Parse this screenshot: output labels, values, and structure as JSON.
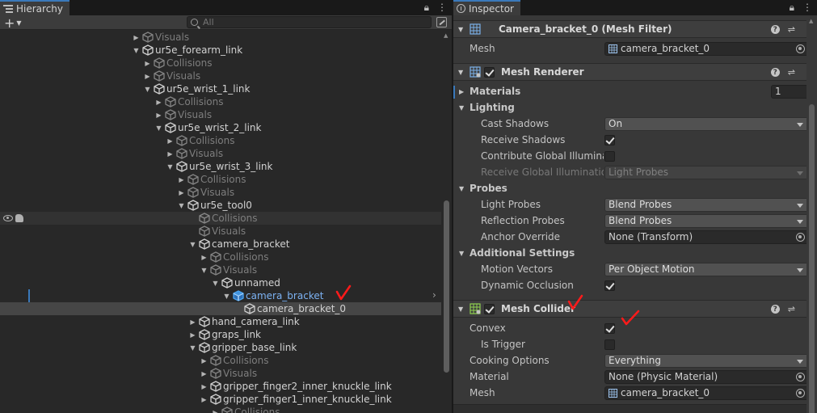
{
  "hierarchy": {
    "tab_label": "Hierarchy",
    "search_placeholder": "All",
    "add_label": "+",
    "rows": [
      {
        "label": "Visuals",
        "depth": 0,
        "arrow": "right",
        "dim": true
      },
      {
        "label": "ur5e_forearm_link",
        "depth": 0,
        "arrow": "down",
        "dim": false
      },
      {
        "label": "Collisions",
        "depth": 1,
        "arrow": "right",
        "dim": true
      },
      {
        "label": "Visuals",
        "depth": 1,
        "arrow": "right",
        "dim": true
      },
      {
        "label": "ur5e_wrist_1_link",
        "depth": 1,
        "arrow": "down",
        "dim": false
      },
      {
        "label": "Collisions",
        "depth": 2,
        "arrow": "right",
        "dim": true
      },
      {
        "label": "Visuals",
        "depth": 2,
        "arrow": "right",
        "dim": true
      },
      {
        "label": "ur5e_wrist_2_link",
        "depth": 2,
        "arrow": "down",
        "dim": false
      },
      {
        "label": "Collisions",
        "depth": 3,
        "arrow": "right",
        "dim": true
      },
      {
        "label": "Visuals",
        "depth": 3,
        "arrow": "right",
        "dim": true
      },
      {
        "label": "ur5e_wrist_3_link",
        "depth": 3,
        "arrow": "down",
        "dim": false
      },
      {
        "label": "Collisions",
        "depth": 4,
        "arrow": "right",
        "dim": true
      },
      {
        "label": "Visuals",
        "depth": 4,
        "arrow": "right",
        "dim": true
      },
      {
        "label": "ur5e_tool0",
        "depth": 4,
        "arrow": "down",
        "dim": false
      },
      {
        "label": "Collisions",
        "depth": 5,
        "arrow": "none",
        "dim": true,
        "hovered": true
      },
      {
        "label": "Visuals",
        "depth": 5,
        "arrow": "none",
        "dim": true
      },
      {
        "label": "camera_bracket",
        "depth": 5,
        "arrow": "down",
        "dim": false
      },
      {
        "label": "Collisions",
        "depth": 6,
        "arrow": "right",
        "dim": true
      },
      {
        "label": "Visuals",
        "depth": 6,
        "arrow": "down",
        "dim": true
      },
      {
        "label": "unnamed",
        "depth": 7,
        "arrow": "down",
        "dim": false
      },
      {
        "label": "camera_bracket",
        "depth": 8,
        "arrow": "down",
        "dim": false,
        "prefab": true
      },
      {
        "label": "camera_bracket_0",
        "depth": 9,
        "arrow": "none",
        "dim": false,
        "selected": true
      },
      {
        "label": "hand_camera_link",
        "depth": 5,
        "arrow": "right",
        "dim": false
      },
      {
        "label": "graps_link",
        "depth": 5,
        "arrow": "right",
        "dim": false
      },
      {
        "label": "gripper_base_link",
        "depth": 5,
        "arrow": "down",
        "dim": false
      },
      {
        "label": "Collisions",
        "depth": 6,
        "arrow": "right",
        "dim": true
      },
      {
        "label": "Visuals",
        "depth": 6,
        "arrow": "right",
        "dim": true
      },
      {
        "label": "gripper_finger2_inner_knuckle_link",
        "depth": 6,
        "arrow": "right",
        "dim": false
      },
      {
        "label": "gripper_finger1_inner_knuckle_link",
        "depth": 6,
        "arrow": "right",
        "dim": false
      },
      {
        "label": "Collisions",
        "depth": 7,
        "arrow": "right",
        "dim": true
      }
    ]
  },
  "inspector": {
    "tab_label": "Inspector",
    "mesh_filter": {
      "title": "Camera_bracket_0 (Mesh Filter)",
      "mesh_label": "Mesh",
      "mesh_value": "camera_bracket_0"
    },
    "mesh_renderer": {
      "title": "Mesh Renderer",
      "materials_label": "Materials",
      "materials_count": "1",
      "lighting_label": "Lighting",
      "cast_shadows_label": "Cast Shadows",
      "cast_shadows_value": "On",
      "receive_shadows_label": "Receive Shadows",
      "contribute_gi_label": "Contribute Global Illuminati",
      "receive_gi_label": "Receive Global Illumination",
      "receive_gi_value": "Light Probes",
      "probes_label": "Probes",
      "light_probes_label": "Light Probes",
      "light_probes_value": "Blend Probes",
      "reflection_probes_label": "Reflection Probes",
      "reflection_probes_value": "Blend Probes",
      "anchor_override_label": "Anchor Override",
      "anchor_override_value": "None (Transform)",
      "additional_settings_label": "Additional Settings",
      "motion_vectors_label": "Motion Vectors",
      "motion_vectors_value": "Per Object Motion",
      "dynamic_occlusion_label": "Dynamic Occlusion"
    },
    "mesh_collider": {
      "title": "Mesh Collider",
      "convex_label": "Convex",
      "is_trigger_label": "Is Trigger",
      "cooking_options_label": "Cooking Options",
      "cooking_options_value": "Everything",
      "material_label": "Material",
      "material_value": "None (Physic Material)",
      "mesh_label": "Mesh",
      "mesh_value": "camera_bracket_0"
    }
  },
  "colors": {
    "selection_blue": "#3a79bb",
    "prefab_blue": "#7cb2f3",
    "annotation_red": "#ff1a1a",
    "collider_green": "#8fd14f"
  }
}
